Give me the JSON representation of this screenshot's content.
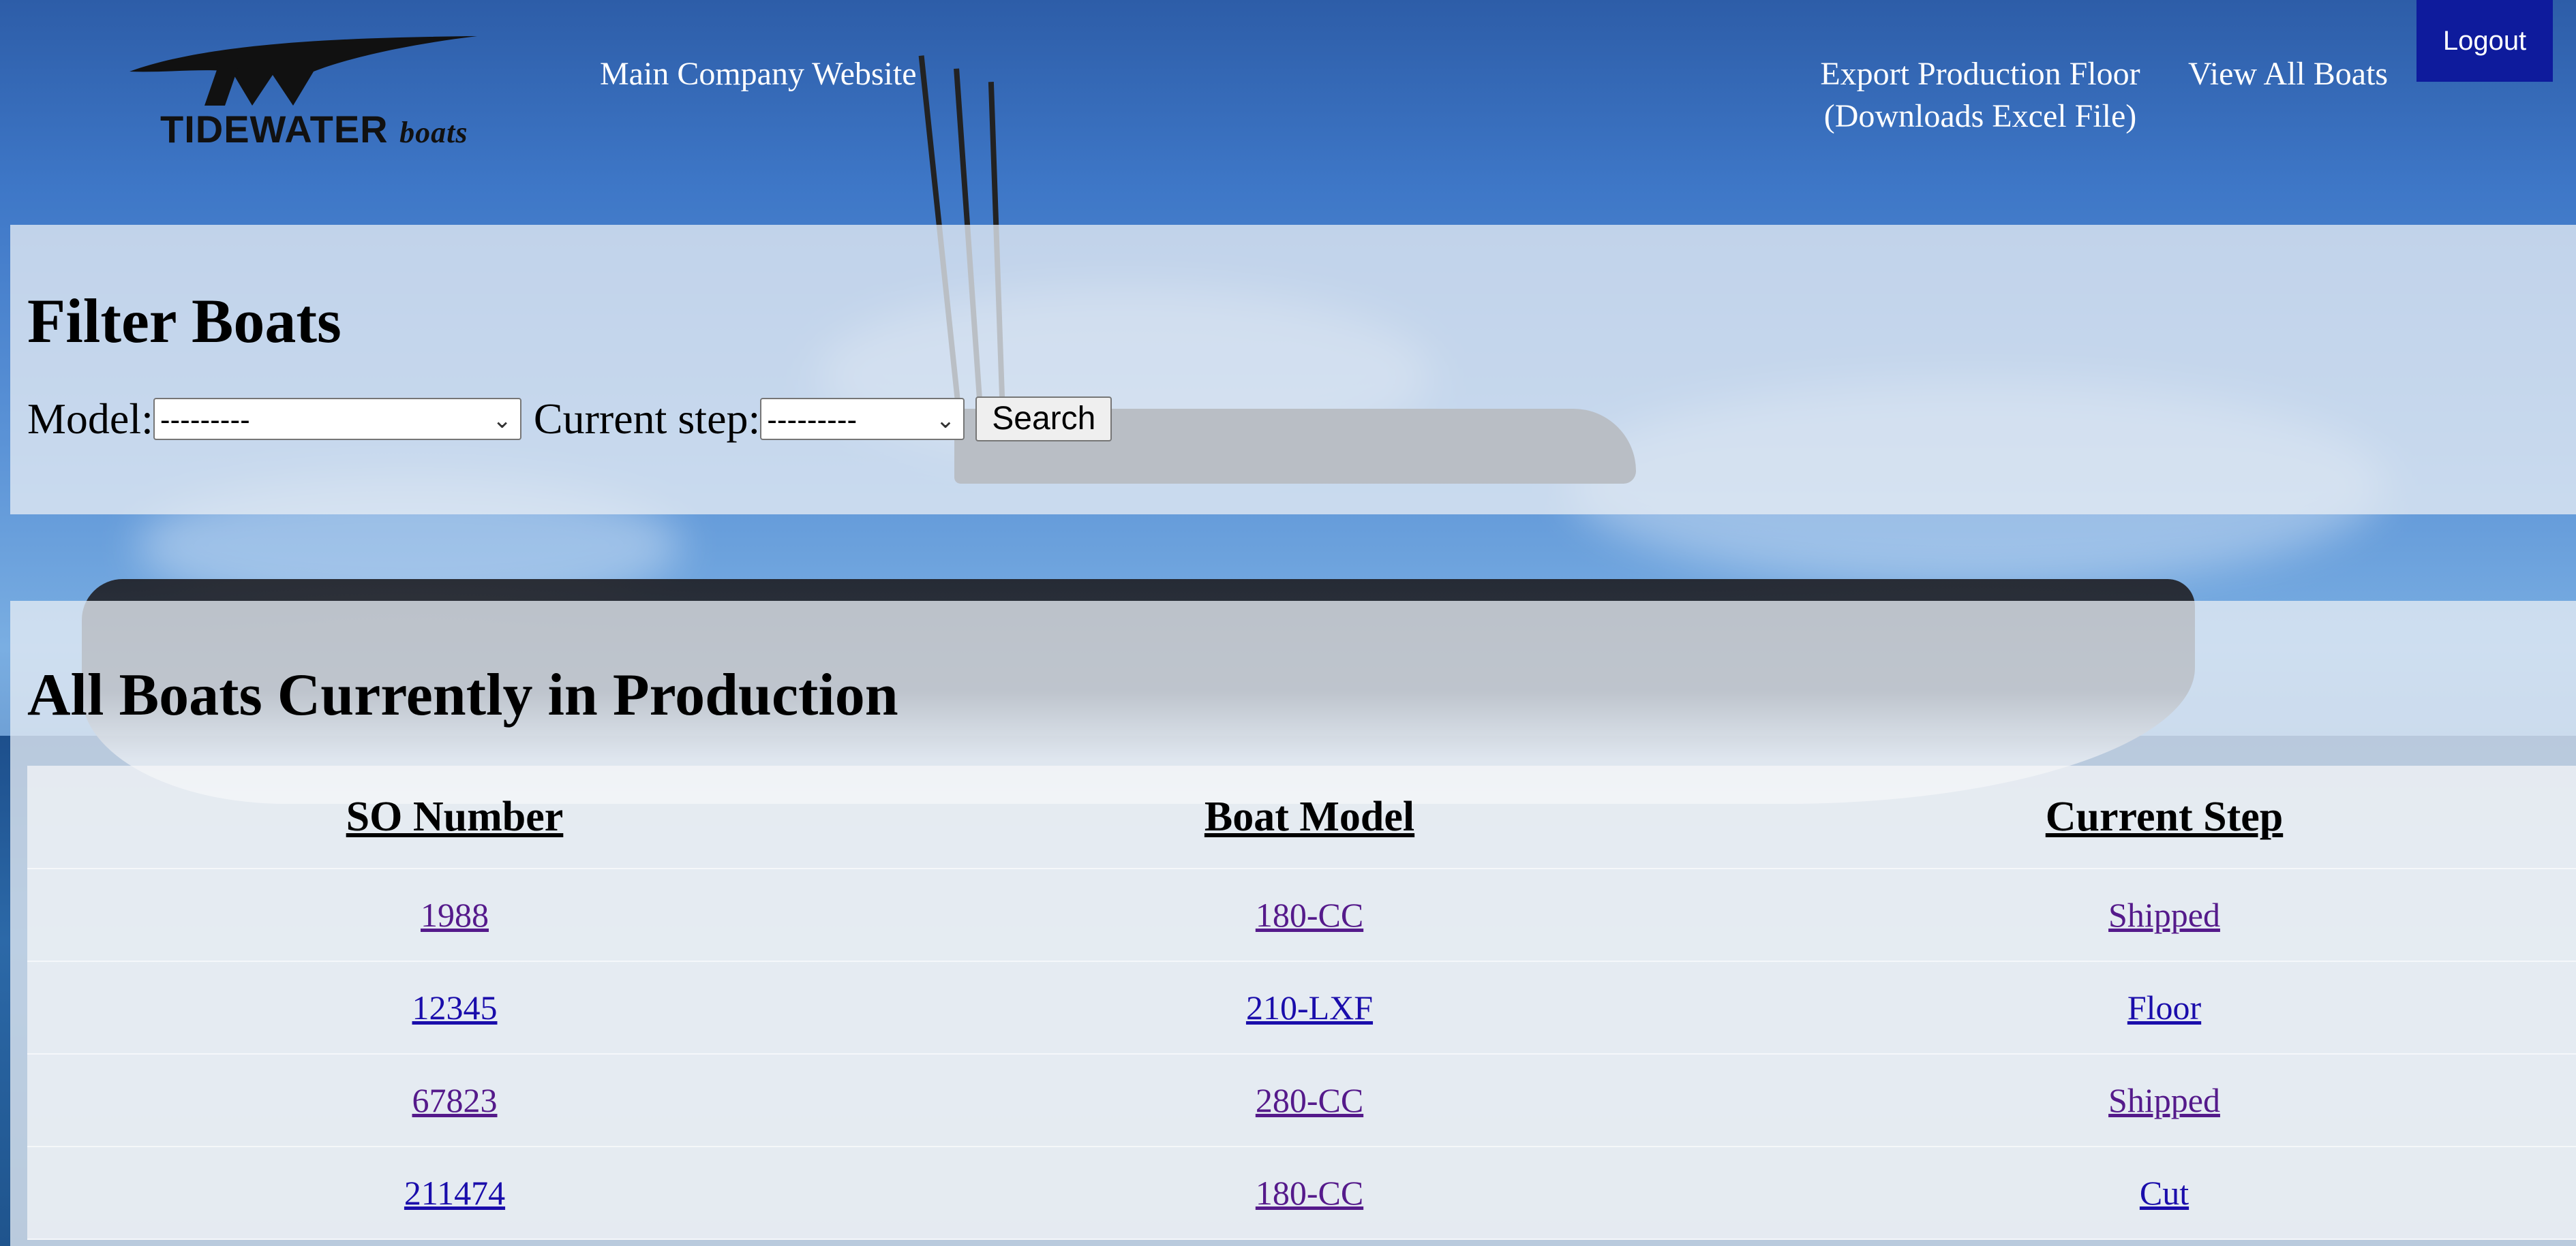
{
  "header": {
    "logo_text": "TIDEWATER",
    "logo_subtext": "boats",
    "nav": {
      "main_site": "Main Company Website",
      "export_line1": "Export Production Floor",
      "export_line2": "(Downloads Excel File)",
      "view_all": "View All Boats"
    },
    "logout": "Logout"
  },
  "filter": {
    "title": "Filter Boats",
    "model_label": "Model:",
    "model_value": "---------",
    "step_label": "Current step:",
    "step_value": "---------",
    "search_label": "Search"
  },
  "production": {
    "title": "All Boats Currently in Production",
    "columns": [
      "SO Number",
      "Boat Model",
      "Current Step"
    ],
    "rows": [
      {
        "so": "1988",
        "model": "180-CC",
        "step": "Shipped"
      },
      {
        "so": "12345",
        "model": "210-LXF",
        "step": "Floor"
      },
      {
        "so": "67823",
        "model": "280-CC",
        "step": "Shipped"
      },
      {
        "so": "211474",
        "model": "180-CC",
        "step": "Cut"
      }
    ]
  },
  "colors": {
    "logout_bg": "#0e1b9c",
    "link": "#1a0dab",
    "visited_link": "#551a8b"
  }
}
